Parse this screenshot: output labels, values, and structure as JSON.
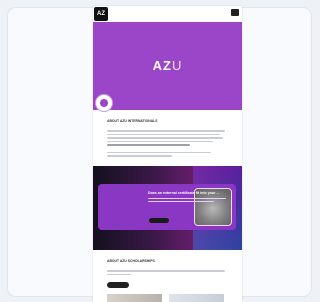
{
  "header": {
    "badge_text": "AZ"
  },
  "hero": {
    "logo_main": "AZ",
    "logo_suffix": "U"
  },
  "section1": {
    "heading": "ABOUT AZU INTERNATIONALS"
  },
  "promo": {
    "title": "Does an external certificate fit into your ..."
  },
  "section2": {
    "heading": "ABOUT AZU SCHOLARSHIPS"
  },
  "colors": {
    "hero_purple": "#9b45c9",
    "promo_dark": "#14101f",
    "promo_accent": "#8a37c4"
  }
}
